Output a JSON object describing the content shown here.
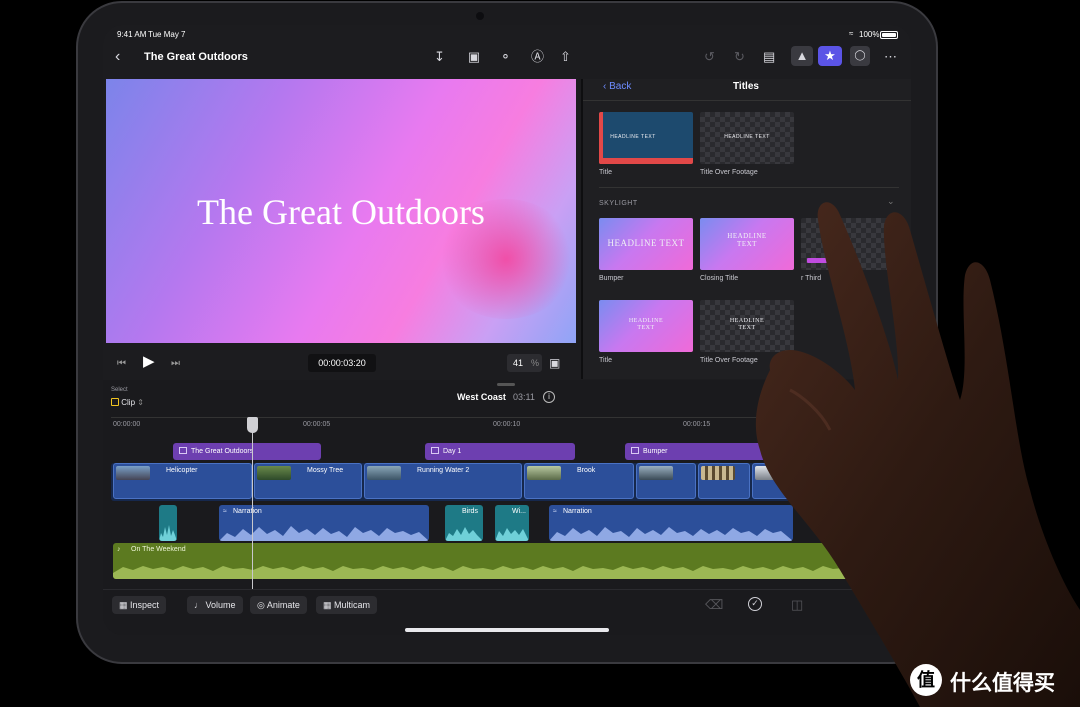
{
  "status": {
    "time": "9:41 AM",
    "date": "Tue May 7",
    "battery": "100%"
  },
  "nav": {
    "back_icon": "chevron-left-icon",
    "title": "The Great Outdoors"
  },
  "toolbar_icons": [
    "download-icon",
    "camera-icon",
    "mic-icon",
    "pen-icon",
    "share-icon"
  ],
  "right_icons": [
    "undo-icon",
    "redo-icon",
    "photo-browser-icon",
    "photos-icon",
    "titles-icon",
    "voiceover-icon",
    "more-icon"
  ],
  "viewer": {
    "title_text": "The Great Outdoors",
    "timecode": "00:00:03:20",
    "zoom": "41",
    "zoom_unit": "%"
  },
  "browser": {
    "back_label": "Back",
    "title": "Titles",
    "section": "SKYLIGHT",
    "row1": [
      {
        "label": "Title",
        "thumb_text": "HEADLINE TEXT"
      },
      {
        "label": "Title Over Footage",
        "thumb_text": "HEADLINE TEXT"
      }
    ],
    "row2": [
      {
        "label": "Bumper",
        "thumb_text": "HEADLINE TEXT"
      },
      {
        "label": "Closing Title",
        "thumb_text": "HEADLINE TEXT"
      },
      {
        "label": "r Third"
      }
    ],
    "row3": [
      {
        "label": "Title",
        "thumb_text": "HEADLINE TEXT"
      },
      {
        "label": "Title Over Footage",
        "thumb_text": "HEADLINE TEXT"
      }
    ]
  },
  "timeline": {
    "select_label": "Select",
    "select_value": "Clip",
    "project": "West Coast",
    "duration": "03:11",
    "ticks": [
      "00:00:00",
      "00:00:05",
      "00:00:10",
      "00:00:15"
    ],
    "titles": [
      "The Great Outdoors",
      "Day 1",
      "Bumper"
    ],
    "video_clips": [
      "Helicopter",
      "Mossy Tree",
      "Running Water 2",
      "Brook"
    ],
    "audio_clips": [
      "Narration",
      "Birds",
      "Wi...",
      "Narration"
    ],
    "music": "On The Weekend"
  },
  "bottom": {
    "inspect": "Inspect",
    "volume": "Volume",
    "animate": "Animate",
    "multicam": "Multicam"
  },
  "watermark": {
    "badge": "值",
    "text": "什么值得买"
  }
}
